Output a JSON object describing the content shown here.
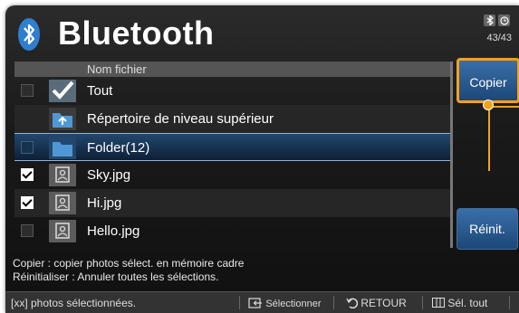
{
  "header": {
    "title": "Bluetooth",
    "count": "43/43"
  },
  "list": {
    "column_header": "Nom fichier",
    "rows": [
      {
        "label": "Tout"
      },
      {
        "label": "Répertoire de niveau supérieur"
      },
      {
        "label": "Folder(12)"
      },
      {
        "label": "Sky.jpg"
      },
      {
        "label": "Hi.jpg"
      },
      {
        "label": "Hello.jpg"
      }
    ]
  },
  "buttons": {
    "copy": "Copier",
    "reset": "Réinit."
  },
  "help": {
    "line1": "Copier : copier photos sélect. en mémoire cadre",
    "line2": "Réinitialiser : Annuler toutes les sélections."
  },
  "footer": {
    "selected": "[xx] photos sélectionnées.",
    "select": "Sélectionner",
    "back": "RETOUR",
    "select_all": "Sél. tout"
  },
  "colors": {
    "accent": "#f4a11b",
    "button": "#2a5b91",
    "selected_row": "#1a3556"
  }
}
